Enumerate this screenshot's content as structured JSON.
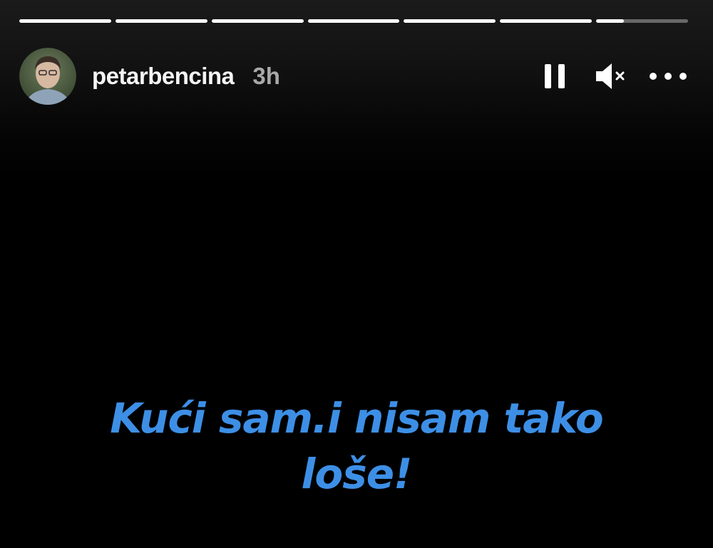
{
  "story": {
    "username": "petarbencina",
    "time": "3h",
    "caption_line1": "Kući sam.i nisam tako",
    "caption_line2": "loše!",
    "progress": [
      1,
      1,
      1,
      1,
      1,
      1,
      0.3
    ]
  },
  "controls": {
    "pause_icon": "pause-icon",
    "mute_icon": "speaker-muted-icon",
    "more_icon": "more-horizontal-icon"
  },
  "colors": {
    "background": "#000000",
    "caption": "#3d8fe6",
    "username": "#f4f4f4",
    "time": "#a8a8a8"
  }
}
